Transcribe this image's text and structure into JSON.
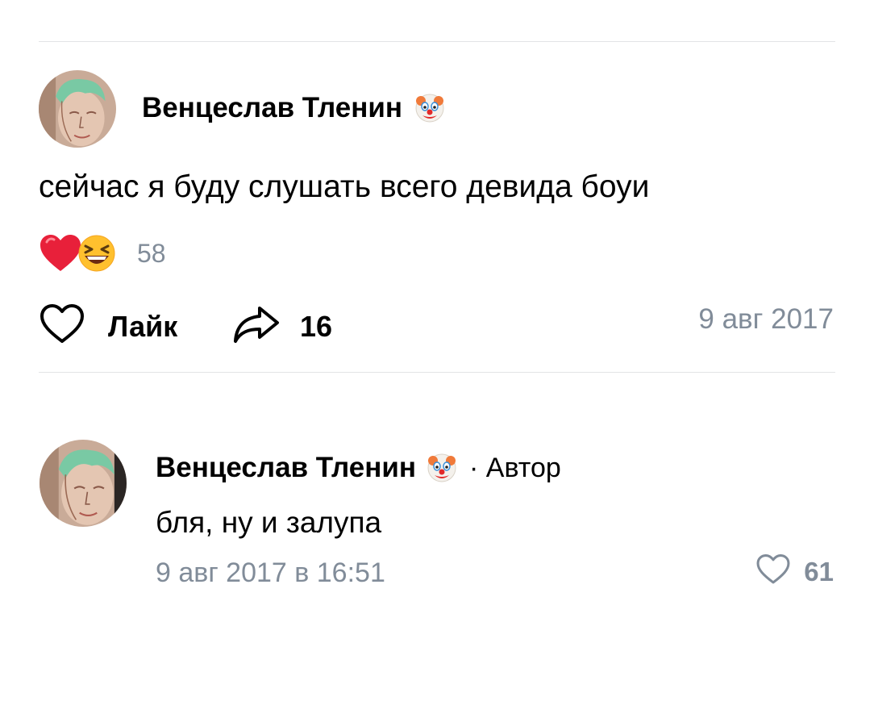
{
  "post": {
    "author_name": "Венцеслав Тленин",
    "author_badge_icon": "clown-face-emoji",
    "text": "сейчас я буду слушать всего девида боуи",
    "reactions": {
      "icons": [
        "red-heart-emoji",
        "laughing-emoji"
      ],
      "count": "58"
    },
    "actions": {
      "like_label": "Лайк",
      "share_count": "16"
    },
    "date": "9 авг 2017"
  },
  "comment": {
    "author_name": "Венцеслав Тленин",
    "author_badge_icon": "clown-face-emoji",
    "tag": "· Автор",
    "text": "бля, ну и залупа",
    "date": "9 авг 2017 в 16:51",
    "like_count": "61"
  },
  "colors": {
    "text_primary": "#000000",
    "text_secondary": "#818c99",
    "divider": "#e3e4e6",
    "heart_red": "#e8203a"
  }
}
